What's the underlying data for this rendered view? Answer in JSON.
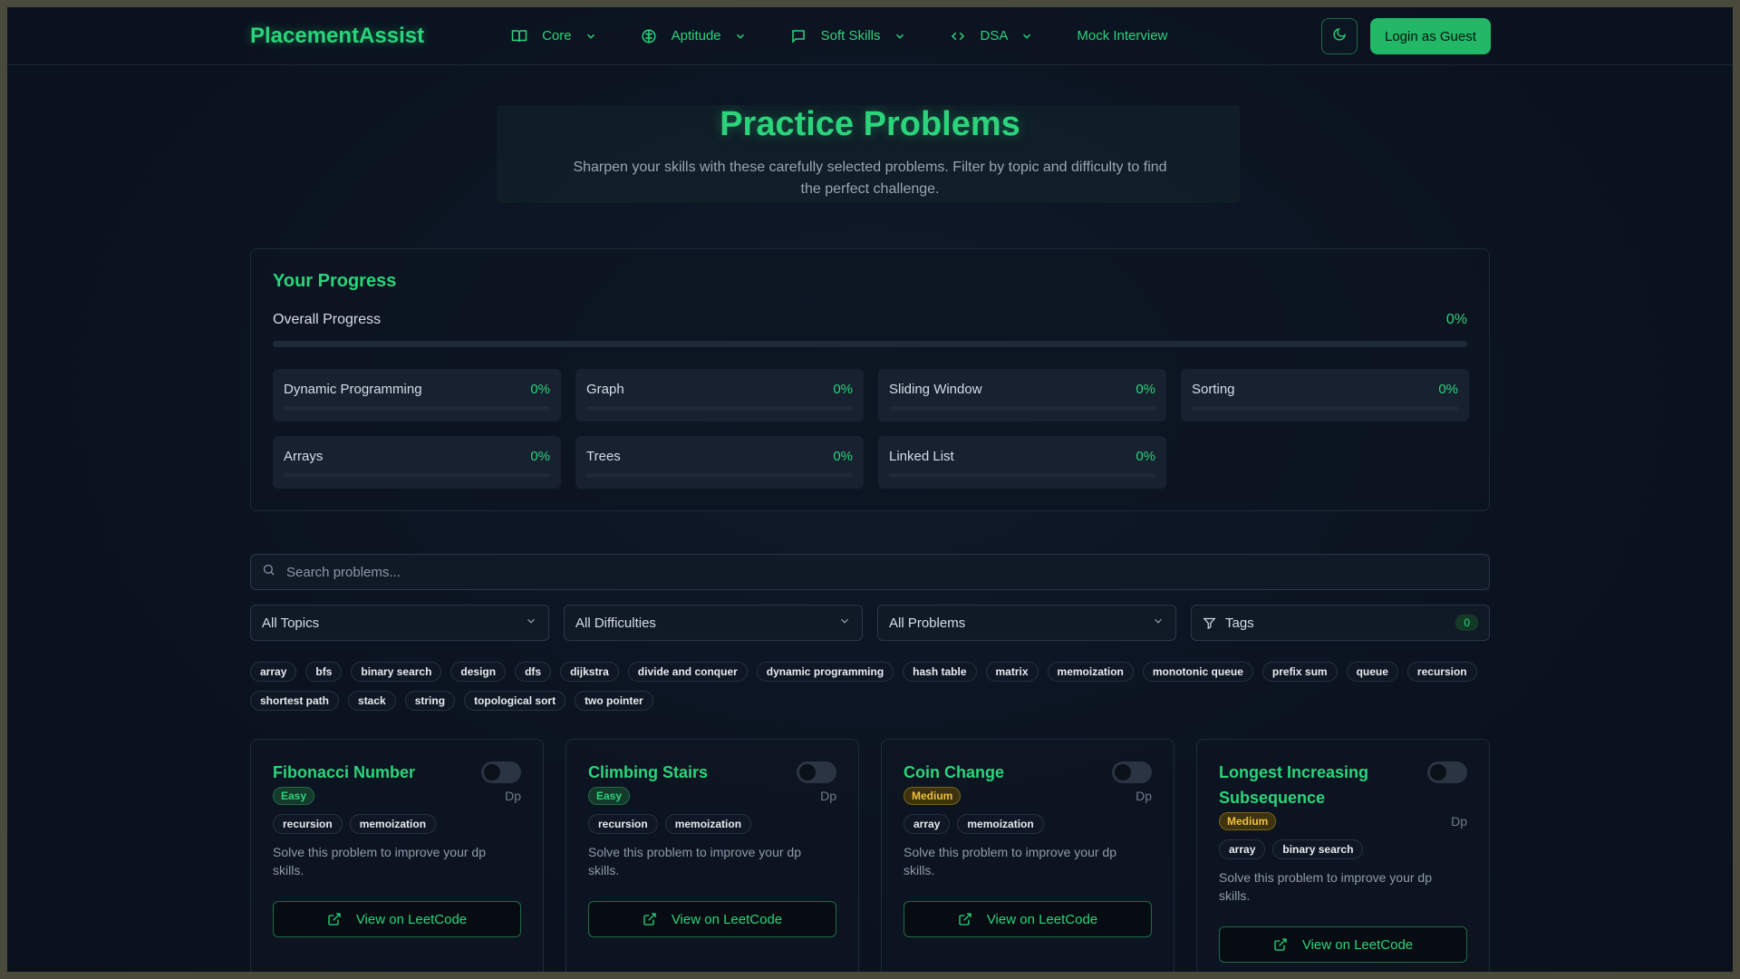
{
  "nav": {
    "brand": "PlacementAssist",
    "menu": [
      {
        "label": "Core",
        "icon": "book-icon"
      },
      {
        "label": "Aptitude",
        "icon": "brain-icon"
      },
      {
        "label": "Soft Skills",
        "icon": "message-icon"
      },
      {
        "label": "DSA",
        "icon": "code-icon"
      }
    ],
    "mock_interview": "Mock Interview",
    "login_label": "Login as Guest"
  },
  "hero": {
    "title": "Practice Problems",
    "subtitle": "Sharpen your skills with these carefully selected problems. Filter by topic and difficulty to find the perfect challenge."
  },
  "progress": {
    "heading": "Your Progress",
    "overall_label": "Overall Progress",
    "overall_pct": "0%",
    "overall_value": 0,
    "topics": [
      {
        "name": "Dynamic Programming",
        "pct": "0%"
      },
      {
        "name": "Graph",
        "pct": "0%"
      },
      {
        "name": "Sliding Window",
        "pct": "0%"
      },
      {
        "name": "Sorting",
        "pct": "0%"
      },
      {
        "name": "Arrays",
        "pct": "0%"
      },
      {
        "name": "Trees",
        "pct": "0%"
      },
      {
        "name": "Linked List",
        "pct": "0%"
      }
    ]
  },
  "search": {
    "placeholder": "Search problems..."
  },
  "filters": {
    "topics": "All Topics",
    "difficulties": "All Difficulties",
    "problems": "All Problems",
    "tags_label": "Tags",
    "tags_count": "0"
  },
  "chips": [
    "array",
    "bfs",
    "binary search",
    "design",
    "dfs",
    "dijkstra",
    "divide and conquer",
    "dynamic programming",
    "hash table",
    "matrix",
    "memoization",
    "monotonic queue",
    "prefix sum",
    "queue",
    "recursion",
    "shortest path",
    "stack",
    "string",
    "topological sort",
    "two pointer"
  ],
  "cards": [
    {
      "title": "Fibonacci Number",
      "difficulty": "Easy",
      "category": "Dp",
      "tags": [
        "recursion",
        "memoization"
      ],
      "desc": "Solve this problem to improve your dp skills.",
      "button": "View on LeetCode"
    },
    {
      "title": "Climbing Stairs",
      "difficulty": "Easy",
      "category": "Dp",
      "tags": [
        "recursion",
        "memoization"
      ],
      "desc": "Solve this problem to improve your dp skills.",
      "button": "View on LeetCode"
    },
    {
      "title": "Coin Change",
      "difficulty": "Medium",
      "category": "Dp",
      "tags": [
        "array",
        "memoization"
      ],
      "desc": "Solve this problem to improve your dp skills.",
      "button": "View on LeetCode"
    },
    {
      "title": "Longest Increasing Subsequence",
      "difficulty": "Medium",
      "category": "Dp",
      "tags": [
        "array",
        "binary search"
      ],
      "desc": "Solve this problem to improve your dp skills.",
      "button": "View on LeetCode"
    }
  ],
  "colors": {
    "accent": "#2bd47b",
    "background": "#0b1320",
    "medium": "#f0c03a"
  }
}
